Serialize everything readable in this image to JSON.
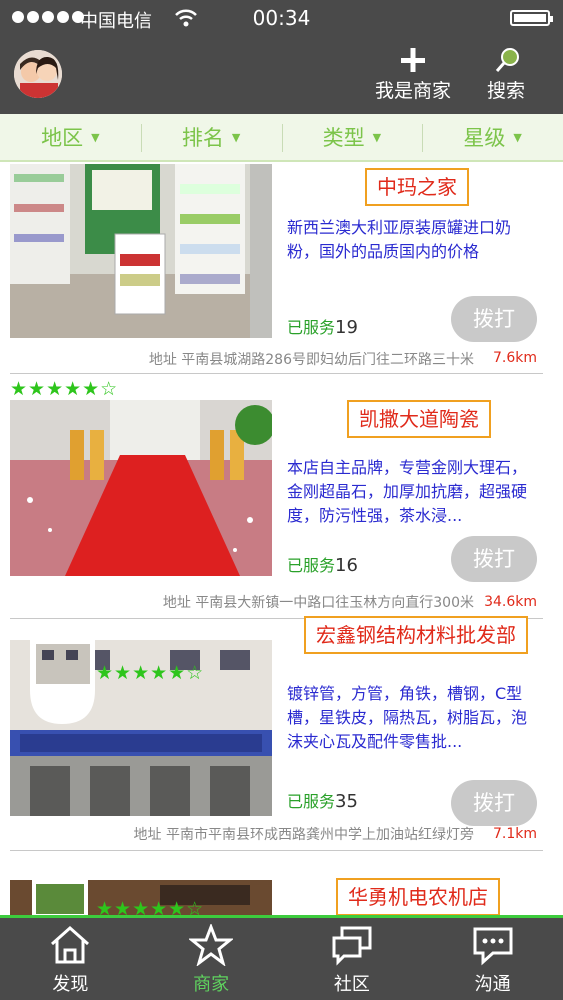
{
  "status_bar": {
    "carrier": "中国电信",
    "time": "00:34"
  },
  "header": {
    "merchant_label": "我是商家",
    "search_label": "搜索"
  },
  "filters": [
    {
      "label": "地区"
    },
    {
      "label": "排名"
    },
    {
      "label": "类型"
    },
    {
      "label": "星级"
    }
  ],
  "listings": [
    {
      "name": "中玛之家",
      "description": "新西兰澳大利亚原装原罐进口奶粉，国外的品质国内的价格",
      "served_label": "已服务",
      "served_count": "19",
      "call_label": "拨打",
      "address": "地址 平南县城湖路286号即妇幼后门往二环路三十米",
      "distance": "7.6km"
    },
    {
      "stars": "★★★★★☆",
      "rating": 5,
      "name": "凯撒大道陶瓷",
      "description": "本店自主品牌，专营金刚大理石，金刚超晶石，加厚加抗磨，超强硬度，防污性强，茶水浸...",
      "served_label": "已服务",
      "served_count": "16",
      "call_label": "拨打",
      "address": "地址 平南县大新镇一中路口往玉林方向直行300米",
      "distance": "34.6km"
    },
    {
      "stars": "★★★★★☆",
      "rating": 5,
      "name": "宏鑫钢结构材料批发部",
      "description": "镀锌管，方管，角铁，槽钢，C型槽，星铁皮，隔热瓦，树脂瓦，泡沫夹心瓦及配件零售批...",
      "served_label": "已服务",
      "served_count": "35",
      "call_label": "拨打",
      "address": "地址 平南市平南县环成西路龚州中学上加油站红绿灯旁",
      "distance": "7.1km"
    },
    {
      "stars": "★★★★★☆",
      "rating": 5,
      "name": "华勇机电农机店"
    }
  ],
  "tabs": [
    {
      "label": "发现",
      "icon": "home-icon"
    },
    {
      "label": "商家",
      "icon": "star-icon"
    },
    {
      "label": "社区",
      "icon": "chat-bubbles-icon"
    },
    {
      "label": "沟通",
      "icon": "message-icon"
    }
  ],
  "colors": {
    "accent": "#5fd35f",
    "header_bg": "#4a4a4a",
    "name_border": "#f0a020",
    "name_text": "#e02a1a",
    "desc_text": "#2a2ad0"
  }
}
